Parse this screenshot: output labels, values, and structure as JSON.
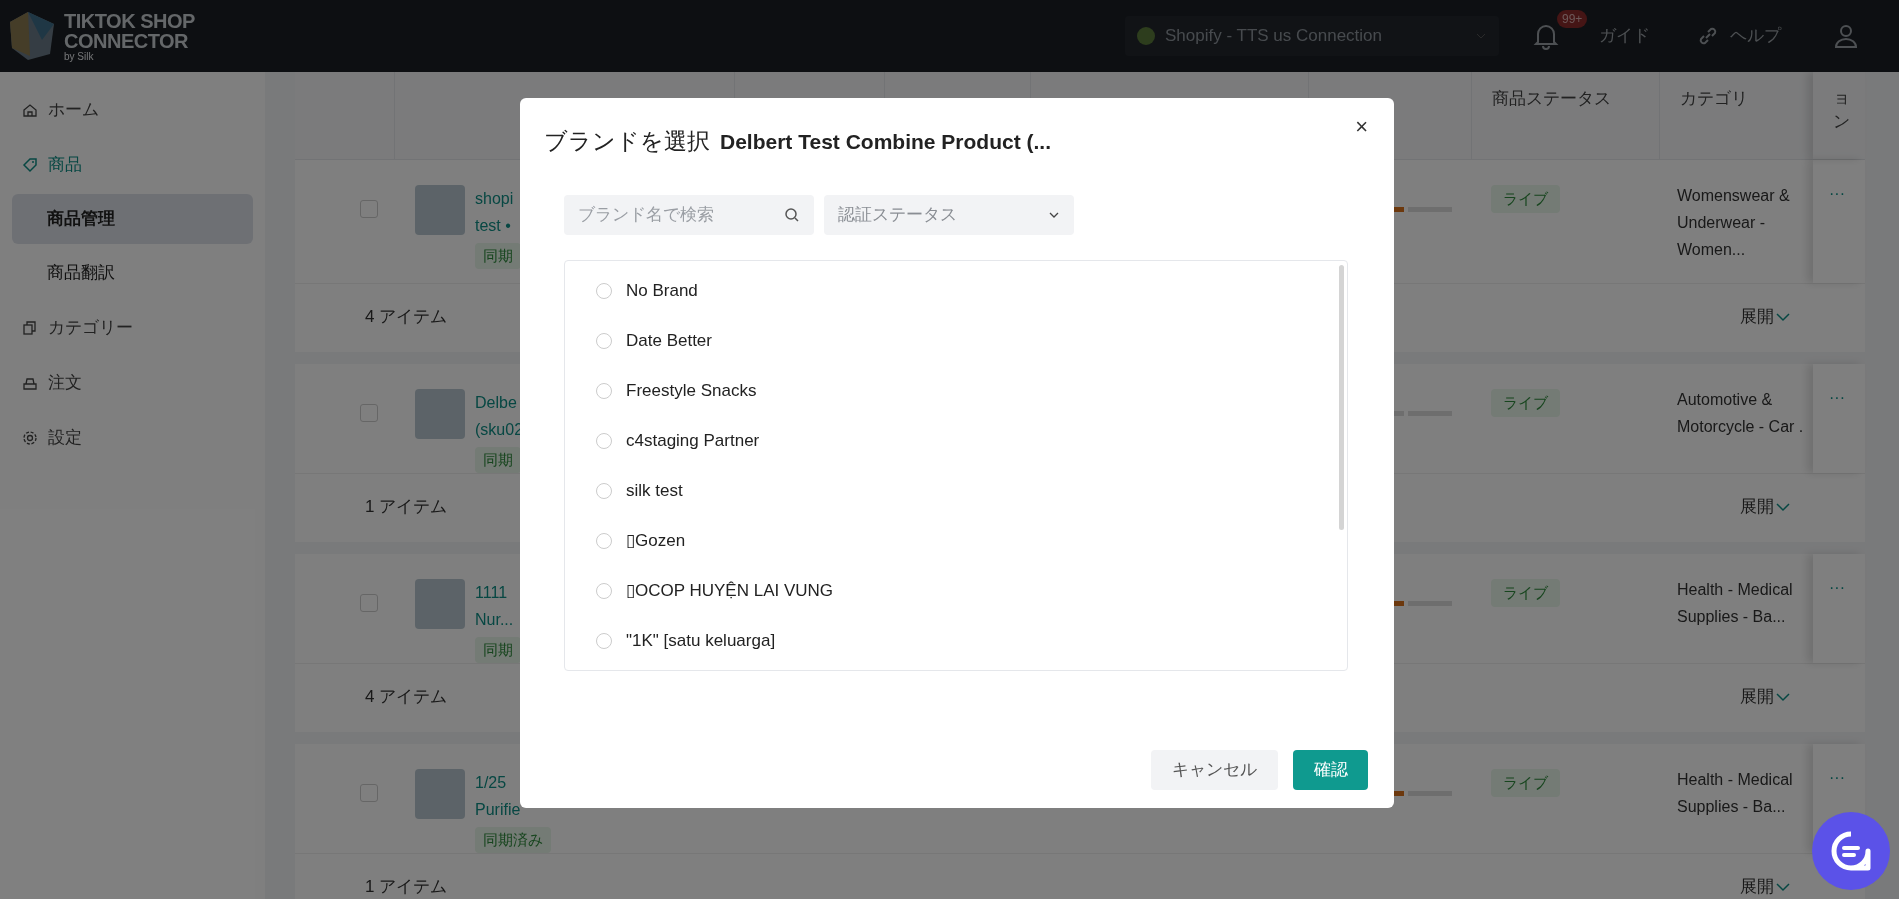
{
  "header": {
    "logo_lines": [
      "TIKTOK SHOP",
      "CONNECTOR"
    ],
    "logo_byline": "by Silk",
    "store_selector": "Shopify - TTS us Connection",
    "notification_badge": "99+",
    "links": [
      "ガイド",
      "ヘルプ"
    ]
  },
  "sidebar": {
    "items": [
      {
        "label": "ホーム",
        "selected": false
      },
      {
        "label": "商品",
        "selected": true,
        "children": [
          {
            "label": "商品管理",
            "selected": true
          },
          {
            "label": "商品翻訳",
            "selected": false
          }
        ]
      },
      {
        "label": "カテゴリー",
        "selected": false
      },
      {
        "label": "注文",
        "selected": false
      },
      {
        "label": "設定",
        "selected": false
      }
    ]
  },
  "table": {
    "columns": [
      "商品ステータス",
      "カテゴリ",
      "ョン"
    ],
    "groups": [
      {
        "checked": false,
        "more": "···",
        "name_lines": [
          "shopi",
          "test •"
        ],
        "sync": "同期",
        "quality_highlight": true,
        "status": "ライブ",
        "category_lines": [
          "Womenswear &",
          "Underwear -",
          "Women..."
        ],
        "item_count": "4 アイテム",
        "expand": "展開"
      },
      {
        "checked": false,
        "more": "···",
        "name_lines": [
          "Delbe",
          "(sku02"
        ],
        "sync": "同期",
        "quality_highlight": false,
        "status": "ライブ",
        "category_lines": [
          "Automotive &",
          "Motorcycle - Car ."
        ],
        "item_count": "1 アイテム",
        "expand": "展開"
      },
      {
        "checked": false,
        "more": "···",
        "name_lines": [
          "1111",
          "Nur..."
        ],
        "sync": "同期",
        "quality_highlight": true,
        "status": "ライブ",
        "category_lines": [
          "Health - Medical",
          "Supplies - Ba..."
        ],
        "item_count": "4 アイテム",
        "expand": "展開"
      },
      {
        "checked": false,
        "more": "···",
        "name_lines": [
          "1/25",
          "Purifie"
        ],
        "sync": "同期済み",
        "quality_highlight": true,
        "status": "ライブ",
        "category_lines": [
          "Health - Medical",
          "Supplies - Ba..."
        ],
        "item_count": "1 アイテム",
        "expand": "展開"
      }
    ]
  },
  "modal": {
    "title": "ブランドを選択",
    "subtitle": "Delbert Test Combine Product (...",
    "close": "×",
    "search": {
      "placeholder": "ブランド名で検索"
    },
    "filter": "認証ステータス",
    "brands": [
      {
        "label": "No Brand",
        "selected": false
      },
      {
        "label": "Date Better",
        "selected": false
      },
      {
        "label": "Freestyle Snacks",
        "selected": false
      },
      {
        "label": "c4staging Partner",
        "selected": false
      },
      {
        "label": "silk test",
        "selected": false
      },
      {
        "label": "▯Gozen",
        "selected": false
      },
      {
        "label": "▯OCOP HUYỆN LAI VUNG",
        "selected": false
      },
      {
        "label": "\"1K\" [satu keluarga]",
        "selected": false
      }
    ],
    "buttons": [
      "キャンセル",
      "確認"
    ]
  }
}
